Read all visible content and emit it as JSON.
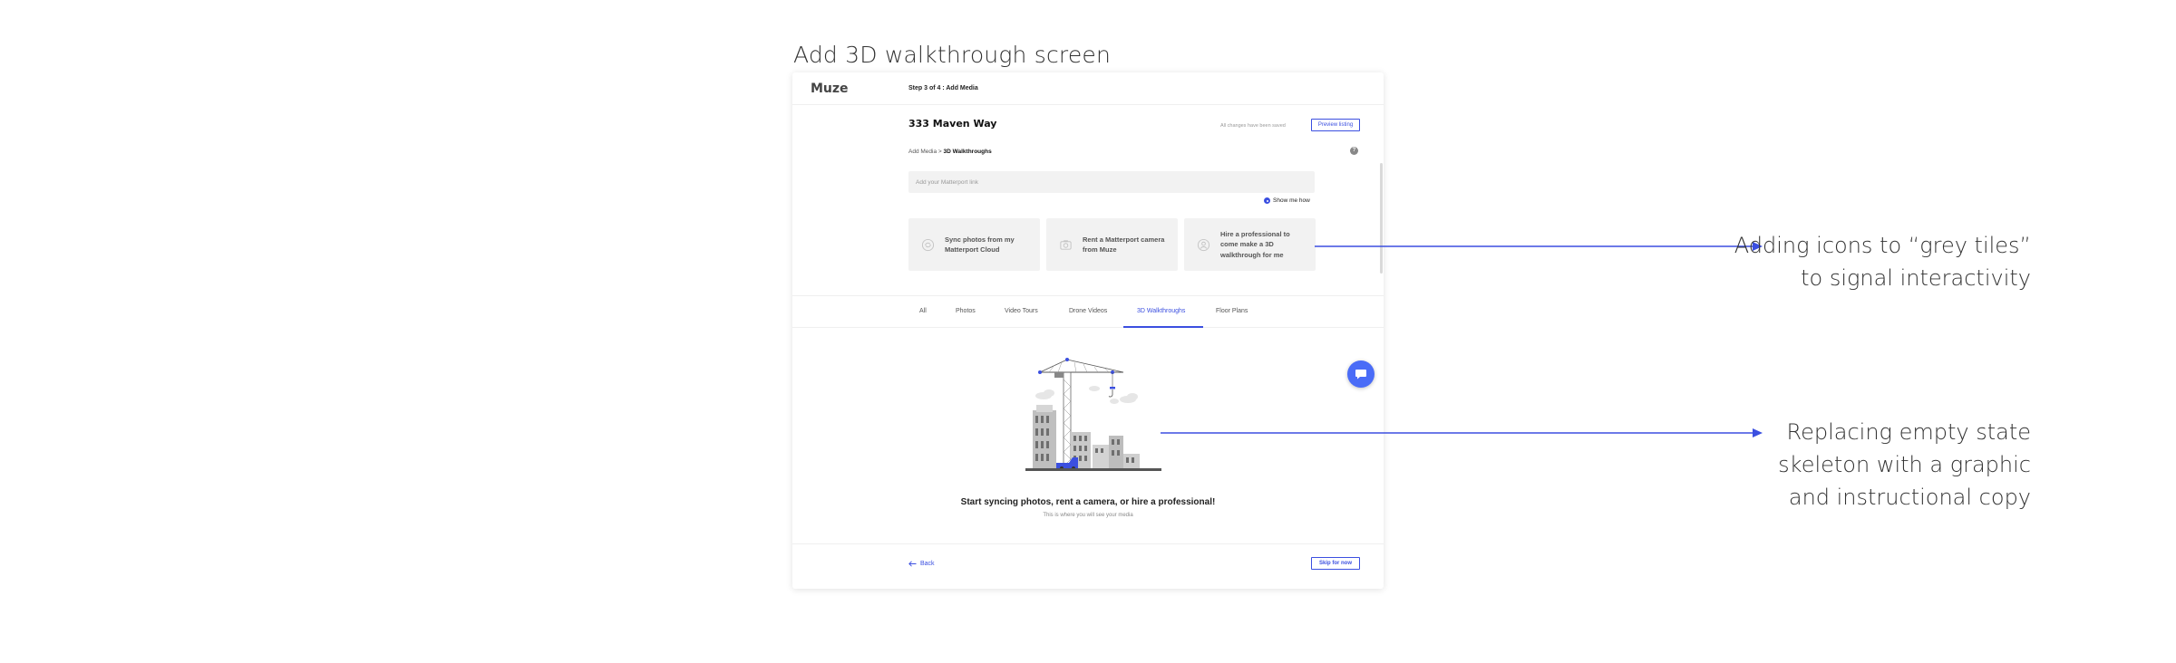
{
  "heading": "Add 3D walkthrough screen",
  "app": {
    "logo": "Muze",
    "step": "Step 3 of 4 : Add Media",
    "listing_title": "333 Maven Way",
    "saved_status": "All changes have been saved",
    "preview_button": "Preview listing",
    "breadcrumb": {
      "parent": "Add Media",
      "separator": ">",
      "current": "3D Walkthroughs"
    },
    "help_icon": "?",
    "matterport_placeholder": "Add your Matterport link",
    "show_me_how": "Show me how",
    "tiles": [
      {
        "label": "Sync photos from my Matterport Cloud",
        "icon": "cloud-sync-icon"
      },
      {
        "label": "Rent a Matterport camera from Muze",
        "icon": "camera-icon"
      },
      {
        "label": "Hire a professional to come make a 3D walkthrough for me",
        "icon": "person-icon"
      }
    ],
    "tabs": [
      "All",
      "Photos",
      "Video Tours",
      "Drone Videos",
      "3D Walkthroughs",
      "Floor Plans"
    ],
    "active_tab": "3D Walkthroughs",
    "empty_state": {
      "title": "Start syncing photos, rent a camera, or hire a professional!",
      "subtitle": "This is where you will see your media",
      "illustration": "construction-crane-graphic"
    },
    "back_label": "Back",
    "skip_button": "Skip for now",
    "accent_color": "#3b4fe0"
  },
  "annotations": [
    {
      "lines": [
        "Adding icons to “grey tiles”",
        "to signal interactivity"
      ]
    },
    {
      "lines": [
        "Replacing empty state",
        "skeleton with a graphic",
        "and instructional copy"
      ]
    }
  ],
  "annotation_color": "#3b4fe0"
}
